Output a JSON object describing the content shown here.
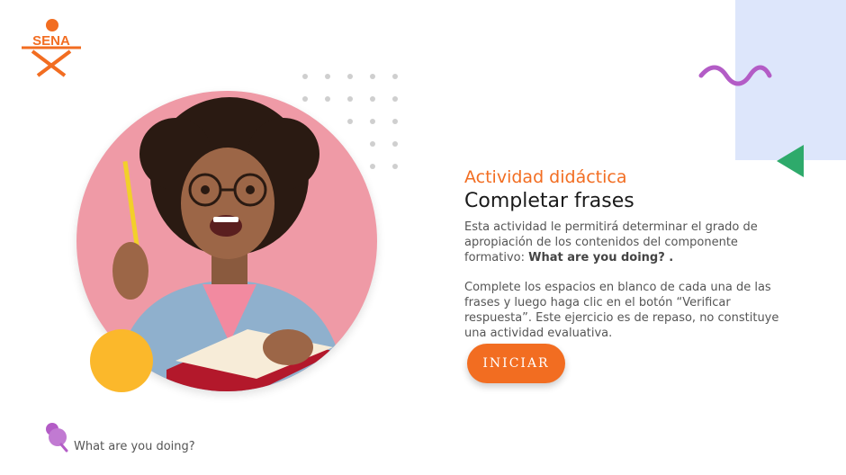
{
  "brand": {
    "logo_text": "SENA",
    "color": "#f26d21"
  },
  "activity": {
    "pretitle": "Actividad didáctica",
    "title": "Completar frases",
    "description_prefix": "Esta actividad le permitirá determinar el grado de apropiación de los contenidos del componente formativo: ",
    "description_bold": "What are you doing? .",
    "instructions": "Complete los espacios en blanco de cada una de las frases y luego haga clic en el botón “Verificar respuesta”. Este ejercicio es de repaso, no constituye una actividad evaluativa.",
    "start_label": "INICIAR"
  },
  "footer": {
    "component_name": "What are you doing?"
  },
  "colors": {
    "accent": "#f26d21",
    "photo_bg": "#ef9aa6",
    "yellow": "#fbb82b",
    "purple": "#b35cc6",
    "green": "#2eaa6b",
    "light_blue": "#dde6fb"
  },
  "icons": [
    "sena-logo",
    "dot-grid-decoration",
    "squiggle-decoration",
    "triangle-decoration",
    "pin-icon"
  ]
}
